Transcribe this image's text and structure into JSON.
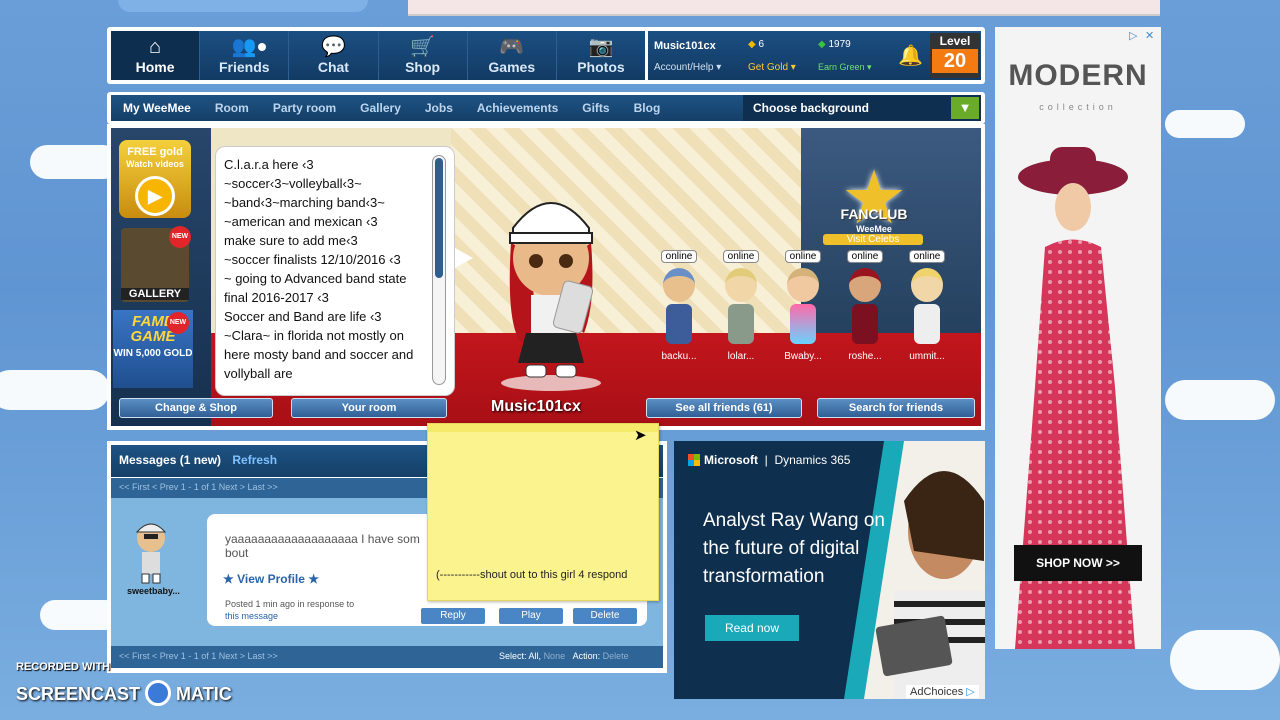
{
  "nav": {
    "items": [
      {
        "label": "Home",
        "icon": "home-icon"
      },
      {
        "label": "Friends",
        "icon": "friends-icon"
      },
      {
        "label": "Chat",
        "icon": "chat-icon"
      },
      {
        "label": "Shop",
        "icon": "cart-icon"
      },
      {
        "label": "Games",
        "icon": "gamepad-icon"
      },
      {
        "label": "Photos",
        "icon": "camera-icon"
      }
    ],
    "username": "Music101cx",
    "account": "Account/Help",
    "gold": "6",
    "green": "1979",
    "get_gold": "Get Gold",
    "earn_green": "Earn Green",
    "level_label": "Level",
    "level": "20"
  },
  "subnav": {
    "items": [
      "My WeeMee",
      "Room",
      "Party room",
      "Gallery",
      "Jobs",
      "Achievements",
      "Gifts",
      "Blog"
    ],
    "choose_bg": "Choose background"
  },
  "room": {
    "free_gold": "FREE gold",
    "watch_videos": "Watch videos",
    "gallery": "GALLERY",
    "new": "NEW",
    "fame": "FAME",
    "game": "GAME",
    "win": "WIN 5,000 GOLD",
    "bio": "C.l.a.r.a here ‹3\n~soccer‹3~volleyball‹3~\n~band‹3~marching band‹3~\n~american and mexican ‹3\nmake sure to add me‹3\n~soccer finalists 12/10/2016 ‹3\n~ going to Advanced band state final 2016-2017 ‹3\nSoccer and Band are life ‹3\n~Clara~ in florida not mostly on here mosty band and soccer and vollyball are",
    "character_name": "Music101cx",
    "fanclub": "FANCLUB",
    "fanclub_sub": "WeeMee",
    "visit_celebs": "Visit Celebs",
    "friends": [
      {
        "status": "online",
        "name": "backu..."
      },
      {
        "status": "online",
        "name": "lolar..."
      },
      {
        "status": "online",
        "name": "Bwaby..."
      },
      {
        "status": "online",
        "name": "roshe..."
      },
      {
        "status": "online",
        "name": "ummit..."
      }
    ],
    "buttons": {
      "change_shop": "Change & Shop",
      "your_room": "Your room",
      "see_all": "See all friends (61)",
      "search": "Search for friends"
    }
  },
  "messages": {
    "title": "Messages (1 new)",
    "refresh": "Refresh",
    "pager": "<< First < Prev 1 - 1 of 1 Next > Last >>",
    "sender": "sweetbaby...",
    "text": "yaaaaaaaaaaaaaaaaaaa I have som bout",
    "view_profile": "View Profile",
    "posted": "Posted 1 min ago in response to",
    "this_message": "this message",
    "reply": "Reply",
    "play": "Play",
    "delete": "Delete",
    "select_label": "Select:",
    "select_all": "All,",
    "select_none": "None",
    "action_label": "Action:",
    "action_delete": "Delete"
  },
  "sticky": {
    "text": "(-----------shout out to this girl 4 respond"
  },
  "ad_right": {
    "brand": "MODERN",
    "collection": "collection",
    "shop_now": "SHOP NOW >>"
  },
  "ad_ms": {
    "brand": "Microsoft",
    "product": "Dynamics 365",
    "headline": "Analyst Ray Wang on the future of digital transformation",
    "cta": "Read now",
    "adchoices": "AdChoices"
  },
  "watermark": {
    "line1": "RECORDED WITH",
    "line2": "SCREENCAST",
    "line3": "MATIC"
  },
  "colors": {
    "accent": "#1b4f82",
    "gold": "#f0c02b",
    "floor": "#c2161c"
  }
}
